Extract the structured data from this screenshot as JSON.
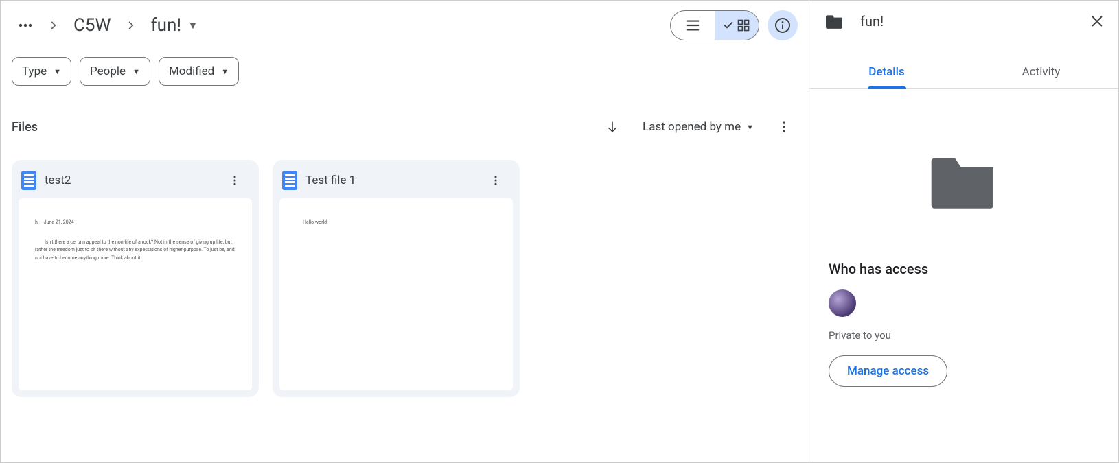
{
  "breadcrumb": {
    "parent": "C5W",
    "current": "fun!"
  },
  "filters": {
    "type": "Type",
    "people": "People",
    "modified": "Modified"
  },
  "section": {
    "title": "Files",
    "sort_label": "Last opened by me"
  },
  "files": [
    {
      "title": "test2",
      "preview_line1": "h — June 21, 2024",
      "preview_body": "Isn't there a certain appeal to the non-life of a rock? Not in the sense of giving up life, but rather the freedom just to sit there without any expectations of higher-purpose. To just be, and not have to become anything more. Think about it"
    },
    {
      "title": "Test file 1",
      "preview_line1": "Hello world",
      "preview_body": ""
    }
  ],
  "sidepanel": {
    "title": "fun!",
    "tabs": {
      "details": "Details",
      "activity": "Activity"
    },
    "access_heading": "Who has access",
    "access_sub": "Private to you",
    "manage_label": "Manage access"
  }
}
